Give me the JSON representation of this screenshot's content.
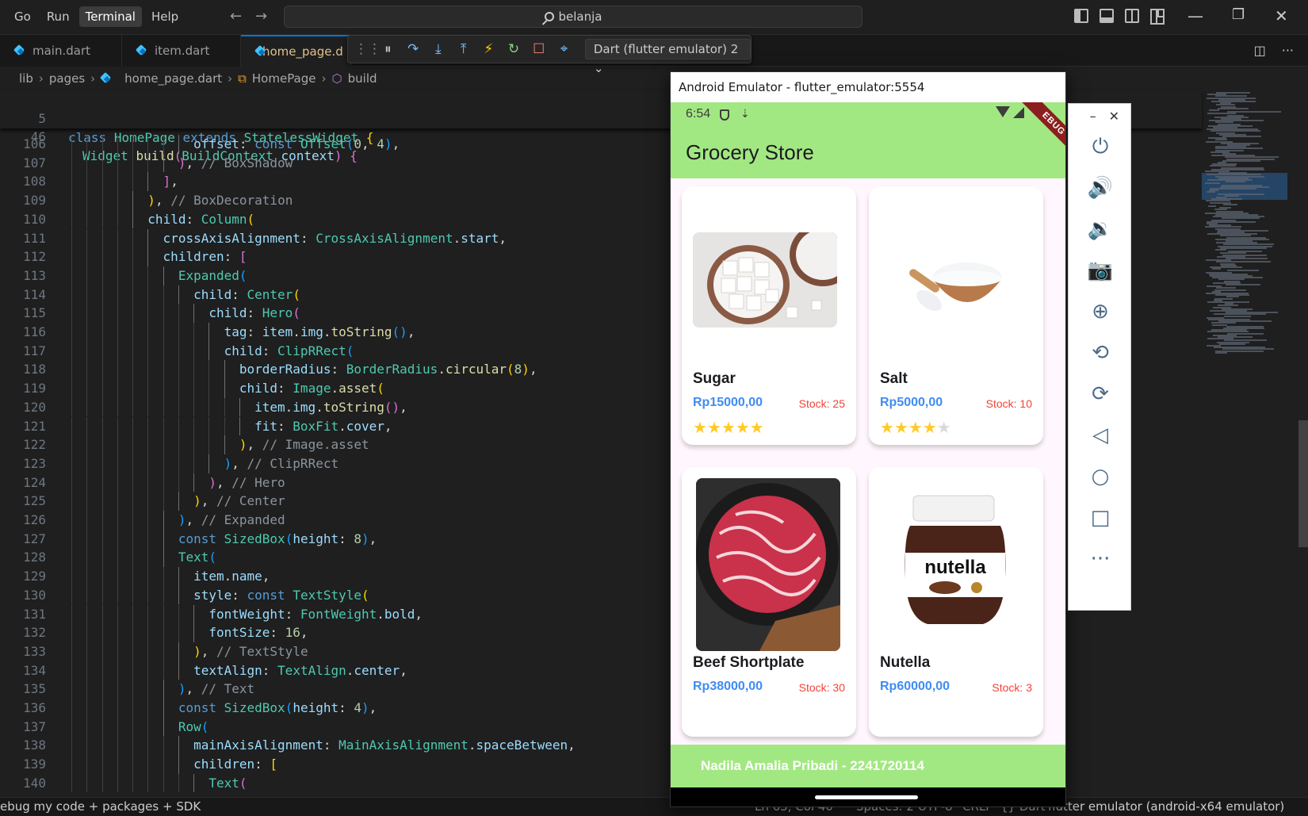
{
  "menu": [
    "Go",
    "Run",
    "Terminal",
    "Help"
  ],
  "search": {
    "text": "belanja"
  },
  "tabs": [
    {
      "label": "main.dart"
    },
    {
      "label": "item.dart"
    },
    {
      "label": "home_page.d"
    }
  ],
  "debug": {
    "target": "Dart (flutter emulator) 2 ⌄"
  },
  "breadcrumb": {
    "lib": "lib",
    "pages": "pages",
    "file": "home_page.dart",
    "class": "HomePage",
    "method": "build"
  },
  "sticky": [
    {
      "num": "5",
      "text": "class HomePage extends StatelessWidget {"
    },
    {
      "num": "46",
      "text": "Widget build(BuildContext context) {"
    }
  ],
  "status": {
    "left": "ebug my code + packages + SDK",
    "pos": "Ln 63, Col 40",
    "spaces": "Spaces: 2",
    "encoding": "UTF-8",
    "eol": "CRLF",
    "lang": "{} Dart",
    "device": "flutter emulator (android-x64 emulator)"
  },
  "emulator": {
    "title": "Android Emulator - flutter_emulator:5554",
    "time": "6:54",
    "ribbon": "EBUG",
    "app_title": "Grocery Store",
    "footer": "Nadila Amalia Pribadi - 2241720114",
    "items": [
      {
        "name": "Sugar",
        "price": "Rp15000,00",
        "stock": "Stock: 25",
        "rating": 5
      },
      {
        "name": "Salt",
        "price": "Rp5000,00",
        "stock": "Stock: 10",
        "rating": 4
      },
      {
        "name": "Beef Shortplate",
        "price": "Rp38000,00",
        "stock": "Stock: 30",
        "rating": 0
      },
      {
        "name": "Nutella",
        "price": "Rp60000,00",
        "stock": "Stock: 3",
        "rating": 0
      }
    ],
    "nutella_logo": "nutella"
  },
  "colors": {
    "appbar": "#a2e882",
    "price": "#3f8cf2",
    "stock": "#f44336",
    "star": "#ffca28"
  },
  "code_lines": [
    {
      "n": 106,
      "indent": 16,
      "html": "<span class='pr'>offset</span><span class='pl'>: </span><span class='kw'>const</span> <span class='ty'>Offset</span><span class='br3'>(</span><span class='nm'>0</span><span class='pl'>, </span><span class='nm'>4</span><span class='br3'>)</span><span class='pl'>,</span>"
    },
    {
      "n": 107,
      "indent": 14,
      "html": "<span class='br2'>)</span><span class='pl'>, </span><span class='cm'>// BoxShadow</span>"
    },
    {
      "n": 108,
      "indent": 12,
      "html": "<span class='br2'>]</span><span class='pl'>,</span>"
    },
    {
      "n": 109,
      "indent": 10,
      "html": "<span class='br1'>)</span><span class='pl'>, </span><span class='cm'>// BoxDecoration</span>"
    },
    {
      "n": 110,
      "indent": 10,
      "html": "<span class='pr'>child</span><span class='pl'>: </span><span class='ty'>Column</span><span class='br1'>(</span>"
    },
    {
      "n": 111,
      "indent": 12,
      "html": "<span class='pr'>crossAxisAlignment</span><span class='pl'>: </span><span class='ty'>CrossAxisAlignment</span><span class='pl'>.</span><span class='pr'>start</span><span class='pl'>,</span>"
    },
    {
      "n": 112,
      "indent": 12,
      "html": "<span class='pr'>children</span><span class='pl'>: </span><span class='br2'>[</span>"
    },
    {
      "n": 113,
      "indent": 14,
      "html": "<span class='ty'>Expanded</span><span class='br3'>(</span>"
    },
    {
      "n": 114,
      "indent": 16,
      "html": "<span class='pr'>child</span><span class='pl'>: </span><span class='ty'>Center</span><span class='br1'>(</span>"
    },
    {
      "n": 115,
      "indent": 18,
      "html": "<span class='pr'>child</span><span class='pl'>: </span><span class='ty'>Hero</span><span class='br2'>(</span>"
    },
    {
      "n": 116,
      "indent": 20,
      "html": "<span class='pr'>tag</span><span class='pl'>: </span><span class='pr'>item</span><span class='pl'>.</span><span class='pr'>img</span><span class='pl'>.</span><span class='fn'>toString</span><span class='br3'>()</span><span class='pl'>,</span>"
    },
    {
      "n": 117,
      "indent": 20,
      "html": "<span class='pr'>child</span><span class='pl'>: </span><span class='ty'>ClipRRect</span><span class='br3'>(</span>"
    },
    {
      "n": 118,
      "indent": 22,
      "html": "<span class='pr'>borderRadius</span><span class='pl'>: </span><span class='ty'>BorderRadius</span><span class='pl'>.</span><span class='fn'>circular</span><span class='br1'>(</span><span class='nm'>8</span><span class='br1'>)</span><span class='pl'>,</span>"
    },
    {
      "n": 119,
      "indent": 22,
      "html": "<span class='pr'>child</span><span class='pl'>: </span><span class='ty'>Image</span><span class='pl'>.</span><span class='fn'>asset</span><span class='br1'>(</span>"
    },
    {
      "n": 120,
      "indent": 24,
      "html": "<span class='pr'>item</span><span class='pl'>.</span><span class='pr'>img</span><span class='pl'>.</span><span class='fn'>toString</span><span class='br2'>()</span><span class='pl'>,</span>"
    },
    {
      "n": 121,
      "indent": 24,
      "html": "<span class='pr'>fit</span><span class='pl'>: </span><span class='ty'>BoxFit</span><span class='pl'>.</span><span class='pr'>cover</span><span class='pl'>,</span>"
    },
    {
      "n": 122,
      "indent": 22,
      "html": "<span class='br1'>)</span><span class='pl'>, </span><span class='cm'>// Image.asset</span>"
    },
    {
      "n": 123,
      "indent": 20,
      "html": "<span class='br3'>)</span><span class='pl'>, </span><span class='cm'>// ClipRRect</span>"
    },
    {
      "n": 124,
      "indent": 18,
      "html": "<span class='br2'>)</span><span class='pl'>, </span><span class='cm'>// Hero</span>"
    },
    {
      "n": 125,
      "indent": 16,
      "html": "<span class='br1'>)</span><span class='pl'>, </span><span class='cm'>// Center</span>"
    },
    {
      "n": 126,
      "indent": 14,
      "html": "<span class='br3'>)</span><span class='pl'>, </span><span class='cm'>// Expanded</span>"
    },
    {
      "n": 127,
      "indent": 14,
      "html": "<span class='kw'>const</span> <span class='ty'>SizedBox</span><span class='br3'>(</span><span class='pr'>height</span><span class='pl'>: </span><span class='nm'>8</span><span class='br3'>)</span><span class='pl'>,</span>"
    },
    {
      "n": 128,
      "indent": 14,
      "html": "<span class='ty'>Text</span><span class='br3'>(</span>"
    },
    {
      "n": 129,
      "indent": 16,
      "html": "<span class='pr'>item</span><span class='pl'>.</span><span class='pr'>name</span><span class='pl'>,</span>"
    },
    {
      "n": 130,
      "indent": 16,
      "html": "<span class='pr'>style</span><span class='pl'>: </span><span class='kw'>const</span> <span class='ty'>TextStyle</span><span class='br1'>(</span>"
    },
    {
      "n": 131,
      "indent": 18,
      "html": "<span class='pr'>fontWeight</span><span class='pl'>: </span><span class='ty'>FontWeight</span><span class='pl'>.</span><span class='pr'>bold</span><span class='pl'>,</span>"
    },
    {
      "n": 132,
      "indent": 18,
      "html": "<span class='pr'>fontSize</span><span class='pl'>: </span><span class='nm'>16</span><span class='pl'>,</span>"
    },
    {
      "n": 133,
      "indent": 16,
      "html": "<span class='br1'>)</span><span class='pl'>, </span><span class='cm'>// TextStyle</span>"
    },
    {
      "n": 134,
      "indent": 16,
      "html": "<span class='pr'>textAlign</span><span class='pl'>: </span><span class='ty'>TextAlign</span><span class='pl'>.</span><span class='pr'>center</span><span class='pl'>,</span>"
    },
    {
      "n": 135,
      "indent": 14,
      "html": "<span class='br3'>)</span><span class='pl'>, </span><span class='cm'>// Text</span>"
    },
    {
      "n": 136,
      "indent": 14,
      "html": "<span class='kw'>const</span> <span class='ty'>SizedBox</span><span class='br3'>(</span><span class='pr'>height</span><span class='pl'>: </span><span class='nm'>4</span><span class='br3'>)</span><span class='pl'>,</span>"
    },
    {
      "n": 137,
      "indent": 14,
      "html": "<span class='ty'>Row</span><span class='br3'>(</span>"
    },
    {
      "n": 138,
      "indent": 16,
      "html": "<span class='pr'>mainAxisAlignment</span><span class='pl'>: </span><span class='ty'>MainAxisAlignment</span><span class='pl'>.</span><span class='pr'>spaceBetween</span><span class='pl'>,</span>"
    },
    {
      "n": 139,
      "indent": 16,
      "html": "<span class='pr'>children</span><span class='pl'>: </span><span class='br1'>[</span>"
    },
    {
      "n": 140,
      "indent": 18,
      "html": "<span class='ty'>Text</span><span class='br2'>(</span>"
    }
  ]
}
